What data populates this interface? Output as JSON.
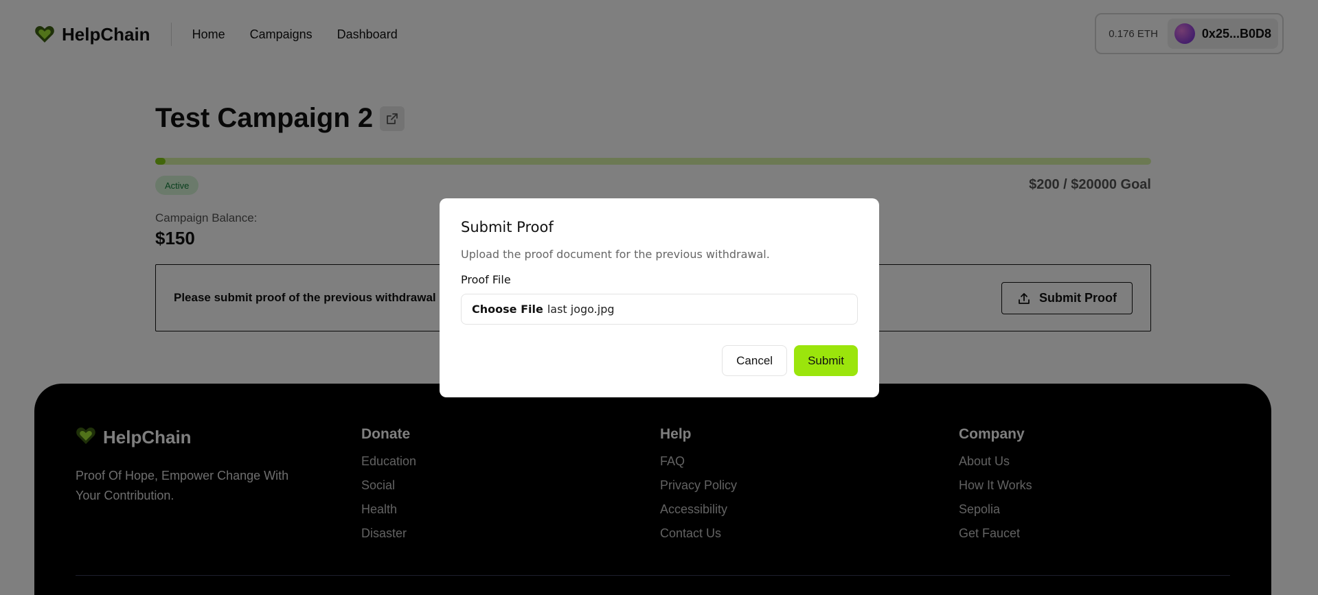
{
  "header": {
    "brand": "HelpChain",
    "nav": [
      "Home",
      "Campaigns",
      "Dashboard"
    ],
    "wallet_balance": "0.176 ETH",
    "wallet_address": "0x25...B0D8"
  },
  "campaign": {
    "title": "Test Campaign 2",
    "progress_fraction": 0.01,
    "status": "Active",
    "goal_text": "$200 / $20000 Goal",
    "balance_label": "Campaign Balance:",
    "balance_value": "$150",
    "notice_text": "Please submit proof of the previous withdrawal",
    "submit_proof_label": "Submit Proof"
  },
  "modal": {
    "title": "Submit Proof",
    "description": "Upload the proof document for the previous withdrawal.",
    "field_label": "Proof File",
    "choose_file_label": "Choose File",
    "file_name": "last jogo.jpg",
    "cancel_label": "Cancel",
    "submit_label": "Submit"
  },
  "footer": {
    "brand": "HelpChain",
    "tagline": "Proof Of Hope, Empower Change With Your Contribution.",
    "columns": [
      {
        "title": "Donate",
        "links": [
          "Education",
          "Social",
          "Health",
          "Disaster"
        ]
      },
      {
        "title": "Help",
        "links": [
          "FAQ",
          "Privacy Policy",
          "Accessibility",
          "Contact Us"
        ]
      },
      {
        "title": "Company",
        "links": [
          "About Us",
          "How It Works",
          "Sepolia",
          "Get Faucet"
        ]
      }
    ]
  },
  "colors": {
    "accent_green": "#a3e635",
    "progress_fill": "#84cc16",
    "status_badge_text": "#15803d"
  }
}
